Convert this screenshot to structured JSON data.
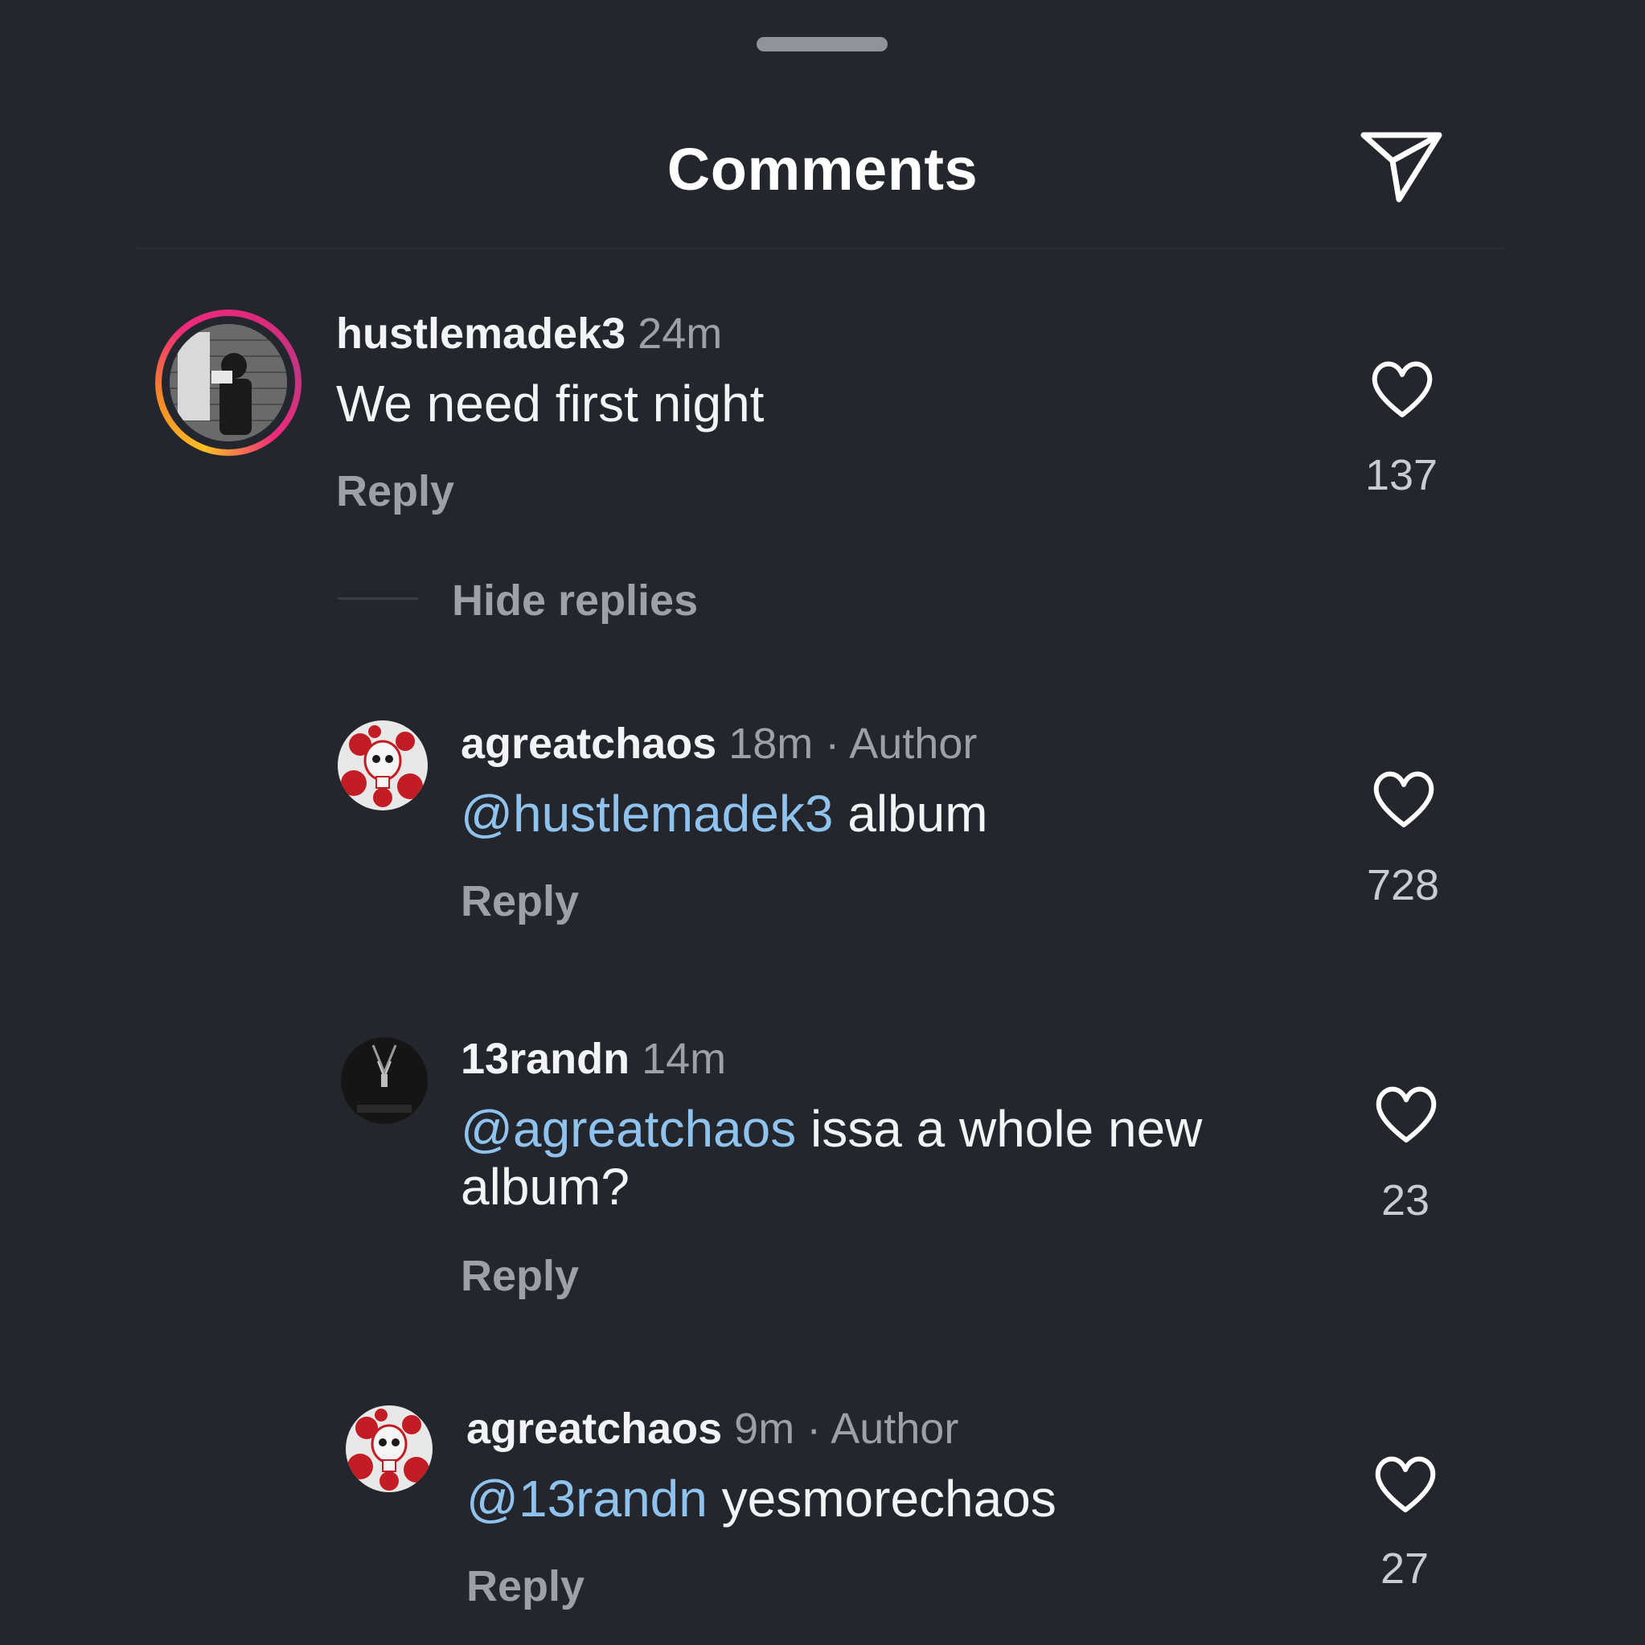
{
  "header": {
    "title": "Comments",
    "share_icon": "paper-plane-icon"
  },
  "comments": [
    {
      "username": "hustlemadek3",
      "time": "24m",
      "text": "We need first night",
      "reply_label": "Reply",
      "likes": "137"
    }
  ],
  "thread": {
    "hide_replies_label": "Hide replies"
  },
  "replies": [
    {
      "username": "agreatchaos",
      "time": "18m",
      "separator": "·",
      "badge": "Author",
      "mention": "@hustlemadek3",
      "text": "album",
      "reply_label": "Reply",
      "likes": "728"
    },
    {
      "username": "13randn",
      "time": "14m",
      "mention": "@agreatchaos",
      "text_line1": "issa a whole new",
      "text_line2": "album?",
      "reply_label": "Reply",
      "likes": "23"
    },
    {
      "username": "agreatchaos",
      "time": "9m",
      "separator": "·",
      "badge": "Author",
      "mention": "@13randn",
      "text": "yesmorechaos",
      "reply_label": "Reply",
      "likes": "27"
    }
  ],
  "colors": {
    "background": "#24262d",
    "mention": "#8fc3ee",
    "muted": "#9ca0a7"
  }
}
